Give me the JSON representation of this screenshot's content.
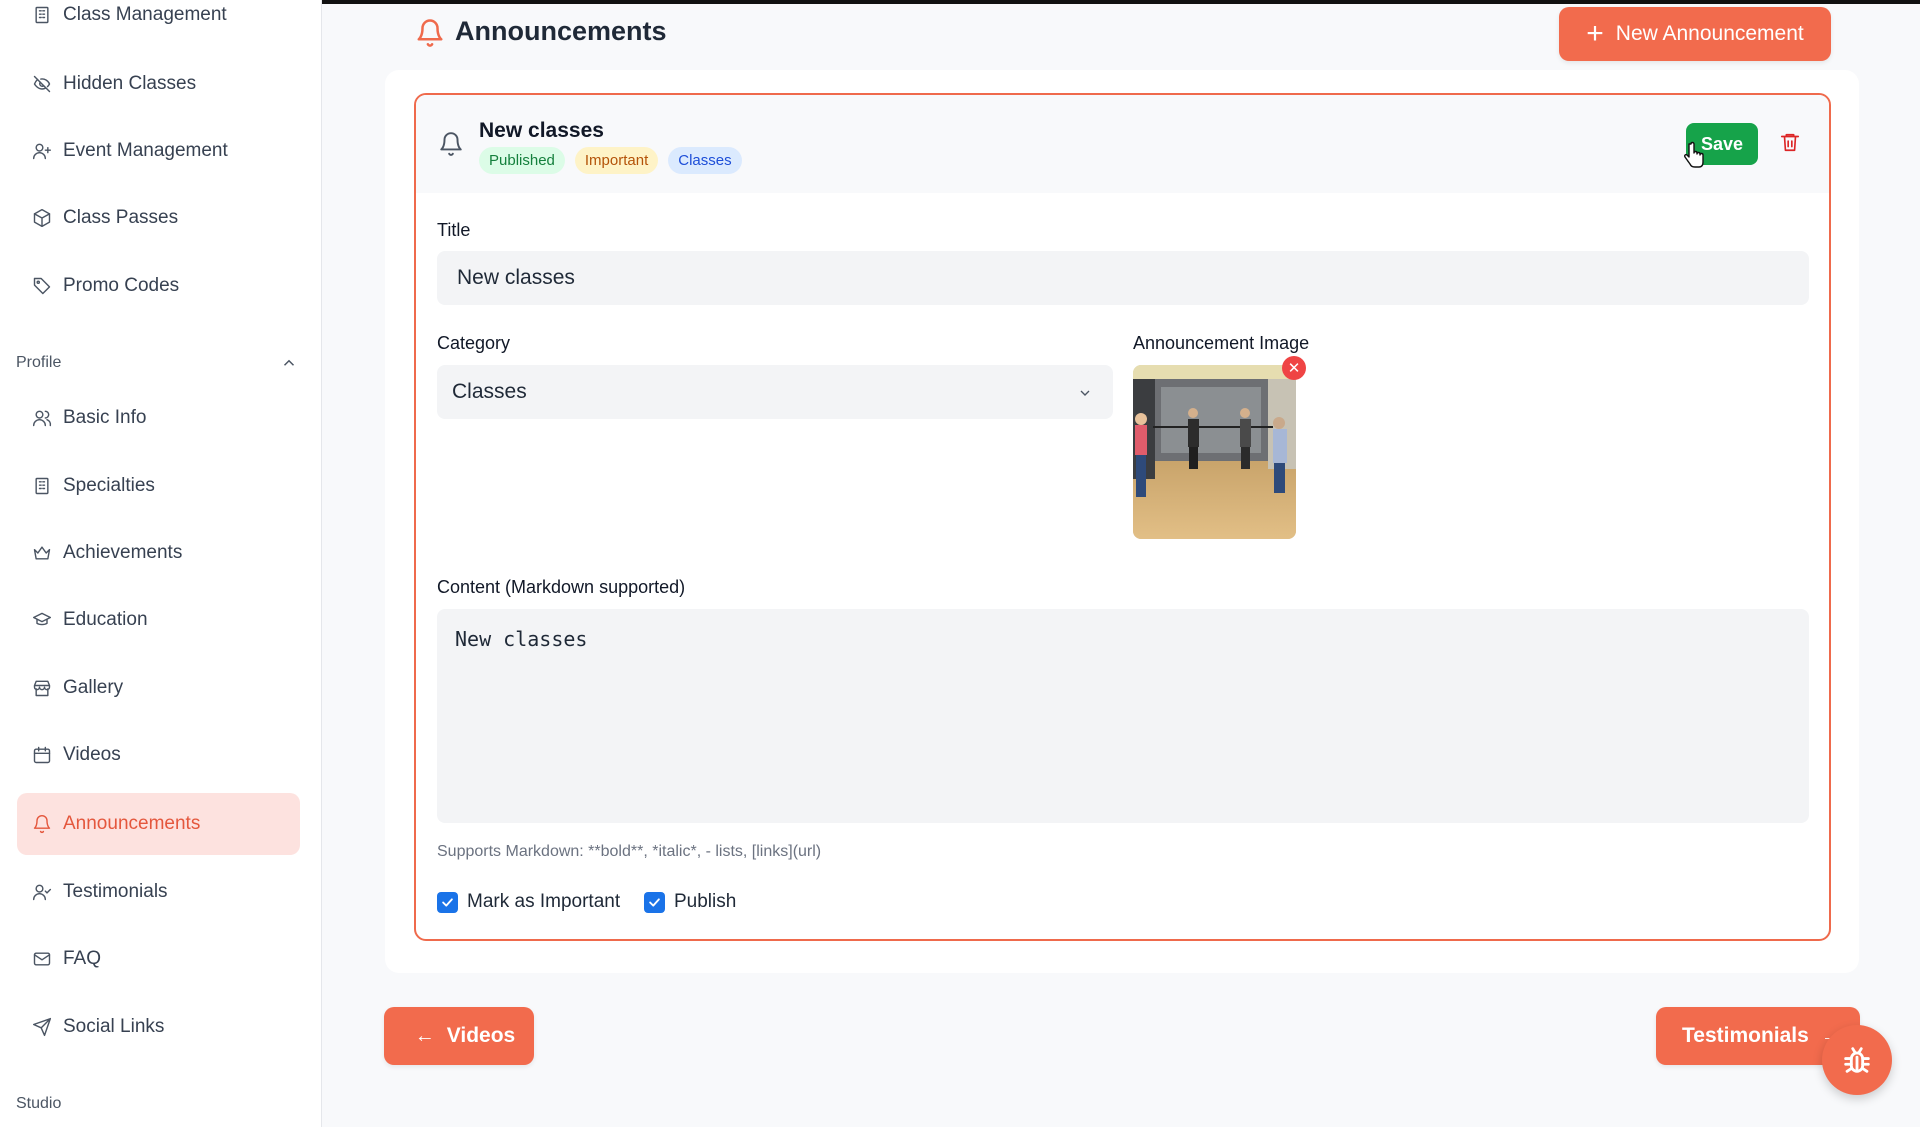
{
  "sidebar": {
    "management_items": [
      {
        "label": "Class Management",
        "icon": "building-icon"
      },
      {
        "label": "Hidden Classes",
        "icon": "eye-off-icon"
      },
      {
        "label": "Event Management",
        "icon": "user-plus-icon"
      },
      {
        "label": "Class Passes",
        "icon": "package-icon"
      },
      {
        "label": "Promo Codes",
        "icon": "tag-icon"
      }
    ],
    "profile_section_label": "Profile",
    "profile_items": [
      {
        "label": "Basic Info",
        "icon": "users-icon"
      },
      {
        "label": "Specialties",
        "icon": "building-icon"
      },
      {
        "label": "Achievements",
        "icon": "crown-icon"
      },
      {
        "label": "Education",
        "icon": "graduation-cap-icon"
      },
      {
        "label": "Gallery",
        "icon": "store-icon"
      },
      {
        "label": "Videos",
        "icon": "calendar-icon"
      },
      {
        "label": "Announcements",
        "icon": "bell-icon",
        "active": true
      },
      {
        "label": "Testimonials",
        "icon": "user-check-icon"
      },
      {
        "label": "FAQ",
        "icon": "mail-icon"
      },
      {
        "label": "Social Links",
        "icon": "send-icon"
      }
    ],
    "studio_section_label": "Studio"
  },
  "header": {
    "title": "Announcements",
    "new_button_label": "New Announcement"
  },
  "announcement": {
    "heading": "New classes",
    "badges": [
      "Published",
      "Important",
      "Classes"
    ],
    "save_label": "Save",
    "title_label": "Title",
    "title_value": "New classes",
    "category_label": "Category",
    "category_value": "Classes",
    "image_label": "Announcement Image",
    "content_label": "Content (Markdown supported)",
    "content_value": "New classes",
    "markdown_hint": "Supports Markdown: **bold**, *italic*, - lists, [links](url)",
    "important_label": "Mark as Important",
    "important_checked": true,
    "publish_label": "Publish",
    "publish_checked": true
  },
  "footer_nav": {
    "prev_label": "Videos",
    "next_label": "Testimonials"
  },
  "colors": {
    "accent": "#f26b4d",
    "save_green": "#16a34a",
    "checkbox_blue": "#1a73e8",
    "active_nav_bg": "#fde2df"
  }
}
